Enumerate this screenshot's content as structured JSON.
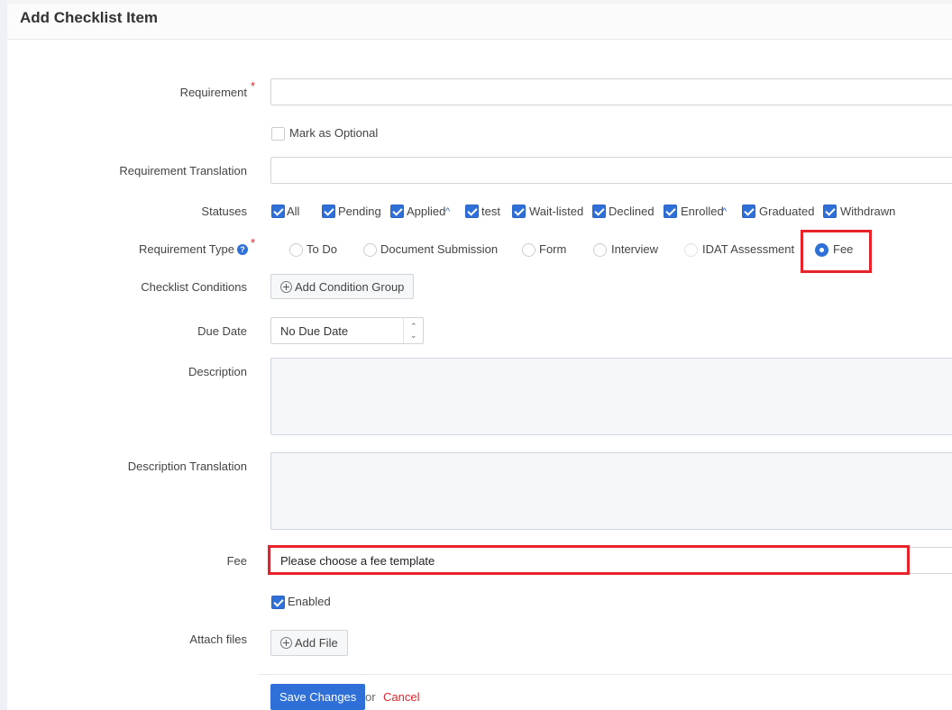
{
  "page": {
    "title": "Add Checklist Item"
  },
  "form": {
    "requirement_label": "Requirement",
    "required_mark": "*",
    "mark_optional_label": "Mark as Optional",
    "requirement_translation_label": "Requirement Translation",
    "statuses_label": "Statuses",
    "statuses": [
      {
        "label": "All",
        "checked": true
      },
      {
        "label": "Pending",
        "checked": true
      },
      {
        "label": "Applied",
        "checked": true,
        "caret": "^"
      },
      {
        "label": "test",
        "checked": true
      },
      {
        "label": "Wait-listed",
        "checked": true
      },
      {
        "label": "Declined",
        "checked": true
      },
      {
        "label": "Enrolled",
        "checked": true,
        "caret": "^"
      },
      {
        "label": "Graduated",
        "checked": true
      },
      {
        "label": "Withdrawn",
        "checked": true
      }
    ],
    "requirement_type_label": "Requirement Type",
    "help_icon_glyph": "?",
    "requirement_types": [
      {
        "label": "To Do",
        "selected": false
      },
      {
        "label": "Document Submission",
        "selected": false
      },
      {
        "label": "Form",
        "selected": false
      },
      {
        "label": "Interview",
        "selected": false
      },
      {
        "label": "IDAT Assessment",
        "selected": false
      },
      {
        "label": "Fee",
        "selected": true
      }
    ],
    "checklist_conditions_label": "Checklist Conditions",
    "add_condition_group_label": "Add Condition Group",
    "due_date_label": "Due Date",
    "due_date_value": "No Due Date",
    "description_label": "Description",
    "description_translation_label": "Description Translation",
    "fee_label": "Fee",
    "fee_value": "Please choose a fee template",
    "enabled_label": "Enabled",
    "attach_files_label": "Attach files",
    "add_file_label": "Add File"
  },
  "footer": {
    "save_label": "Save Changes",
    "or_label": "or",
    "cancel_label": "Cancel"
  },
  "colors": {
    "accent": "#2f6fd8",
    "highlight": "#e8232a",
    "required": "#e0262b"
  }
}
